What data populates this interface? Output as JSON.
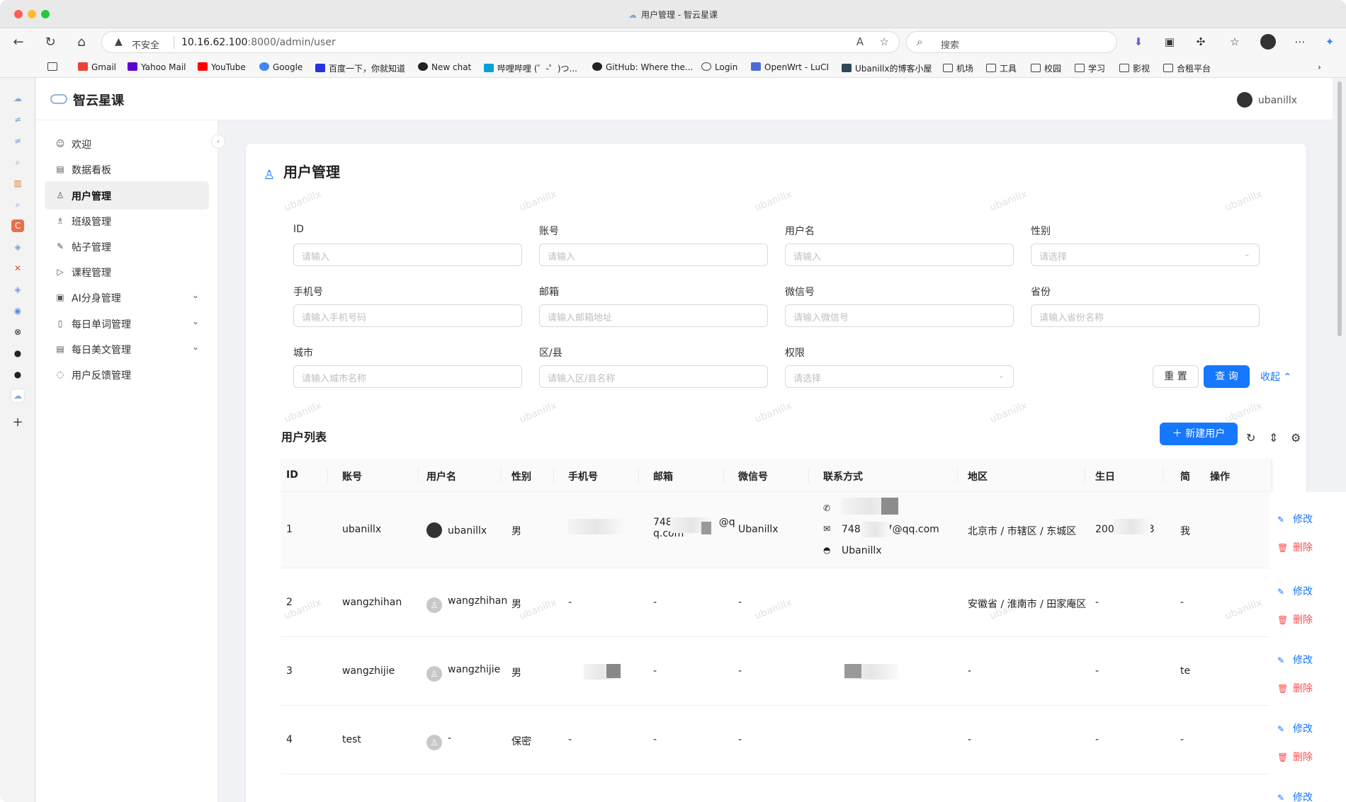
{
  "window": {
    "title": "用户管理 - 智云星课"
  },
  "browser": {
    "insecure_label": "不安全",
    "url_host": "10.16.62.100",
    "url_rest": ":8000/admin/user",
    "search_placeholder": "搜索",
    "bookmarks": [
      "Gmail",
      "Yahoo Mail",
      "YouTube",
      "Google",
      "百度一下，你就知道",
      "New chat",
      "哔哩哔哩 (゜-゜)つ...",
      "GitHub: Where the...",
      "Login",
      "OpenWrt - LuCI",
      "Ubanillx的博客小屋",
      "机场",
      "工具",
      "校园",
      "学习",
      "影视",
      "合租平台"
    ]
  },
  "header": {
    "app_name": "智云星课",
    "username": "ubanillx"
  },
  "sidebar": {
    "items": [
      {
        "label": "欢迎",
        "icon": "smile-icon"
      },
      {
        "label": "数据看板",
        "icon": "chart-icon"
      },
      {
        "label": "用户管理",
        "icon": "user-icon"
      },
      {
        "label": "班级管理",
        "icon": "team-icon"
      },
      {
        "label": "帖子管理",
        "icon": "edit-icon"
      },
      {
        "label": "课程管理",
        "icon": "play-icon"
      },
      {
        "label": "AI分身管理",
        "icon": "robot-icon"
      },
      {
        "label": "每日单词管理",
        "icon": "book-icon"
      },
      {
        "label": "每日美文管理",
        "icon": "file-icon"
      },
      {
        "label": "用户反馈管理",
        "icon": "message-icon"
      }
    ]
  },
  "page": {
    "title": "用户管理",
    "watermark": "ubanillx",
    "filters": {
      "id": {
        "label": "ID",
        "placeholder": "请输入"
      },
      "account": {
        "label": "账号",
        "placeholder": "请输入"
      },
      "username": {
        "label": "用户名",
        "placeholder": "请输入"
      },
      "gender": {
        "label": "性别",
        "placeholder": "请选择"
      },
      "phone": {
        "label": "手机号",
        "placeholder": "请输入手机号码"
      },
      "email": {
        "label": "邮箱",
        "placeholder": "请输入邮箱地址"
      },
      "wechat": {
        "label": "微信号",
        "placeholder": "请输入微信号"
      },
      "province": {
        "label": "省份",
        "placeholder": "请输入省份名称"
      },
      "city": {
        "label": "城市",
        "placeholder": "请输入城市名称"
      },
      "district": {
        "label": "区/县",
        "placeholder": "请输入区/县名称"
      },
      "role": {
        "label": "权限",
        "placeholder": "请选择"
      }
    },
    "reset_label": "重 置",
    "query_label": "查 询",
    "collapse_label": "收起",
    "list_title": "用户列表",
    "new_user_label": "新建用户",
    "columns": [
      "ID",
      "账号",
      "用户名",
      "性别",
      "手机号",
      "邮箱",
      "微信号",
      "联系方式",
      "地区",
      "生日",
      "简",
      "操作"
    ],
    "rows": [
      {
        "id": "1",
        "account": "ubanillx",
        "username": "ubanillx",
        "gender": "男",
        "phone": "",
        "email_a": "748",
        "email_b": "@q",
        "email_c": "q.com",
        "wechat": "Ubanillx",
        "contact_email": "748",
        "contact_email_tail": "7@qq.com",
        "contact_wechat": "Ubanillx",
        "region": "北京市 / 市辖区 / 东城区",
        "birthday_a": "200",
        "birthday_b": "3",
        "extra": "我"
      },
      {
        "id": "2",
        "account": "wangzhihan",
        "username": "wangzhihan",
        "gender": "男",
        "phone": "-",
        "email": "-",
        "wechat": "-",
        "region": "安徽省 / 淮南市 / 田家庵区",
        "birthday": "-",
        "extra": "-"
      },
      {
        "id": "3",
        "account": "wangzhijie",
        "username": "wangzhijie",
        "gender": "男",
        "email": "-",
        "wechat": "-",
        "region": "-",
        "birthday": "-",
        "extra": "te"
      },
      {
        "id": "4",
        "account": "test",
        "username": "-",
        "gender": "保密",
        "phone": "-",
        "email": "-",
        "wechat": "-",
        "region": "-",
        "birthday": "-",
        "extra": "-"
      }
    ],
    "edit_label": "修改",
    "delete_label": "删除"
  }
}
